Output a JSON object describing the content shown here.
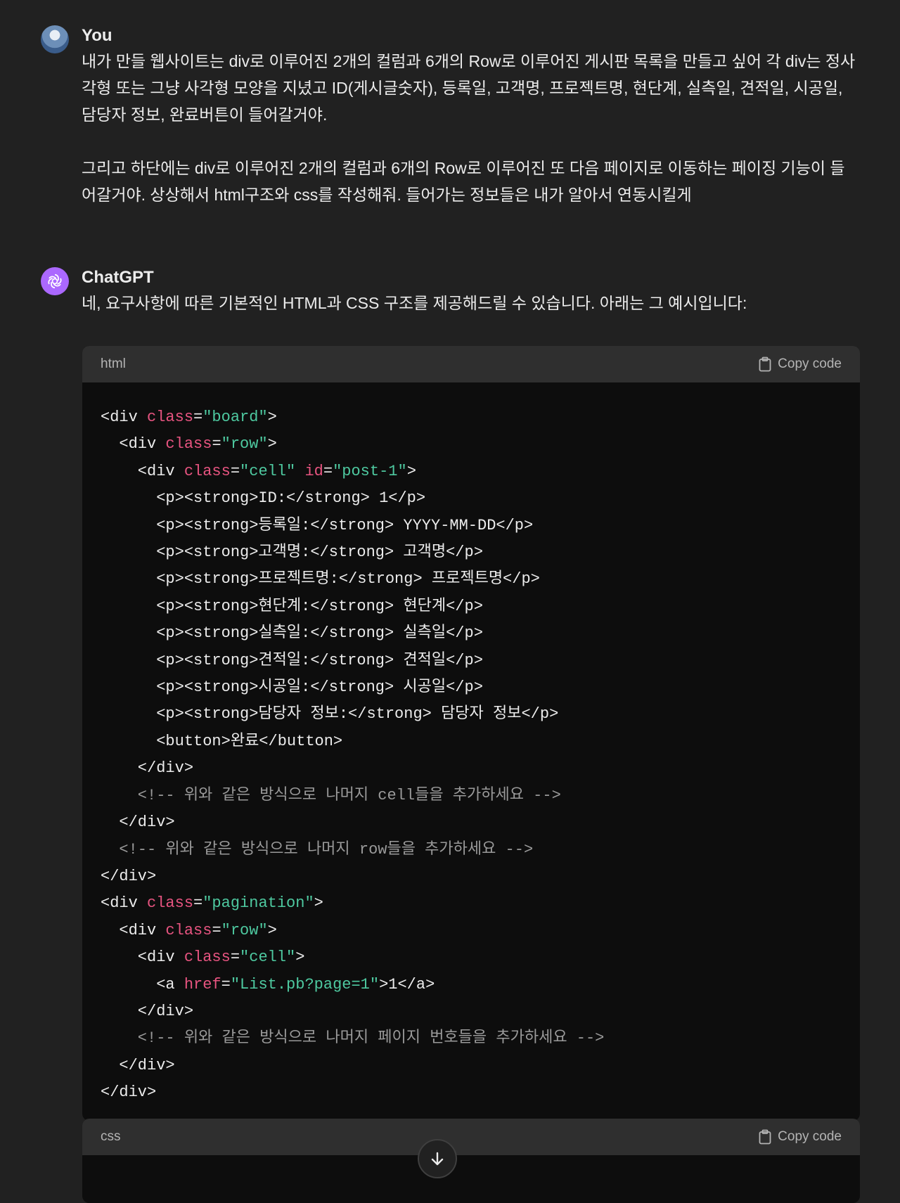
{
  "user_message": {
    "author": "You",
    "paragraphs": [
      "내가 만들 웹사이트는 div로 이루어진 2개의 컬럼과 6개의 Row로 이루어진 게시판 목록을 만들고 싶어 각 div는 정사각형 또는 그냥 사각형 모양을 지녔고 ID(게시글숫자), 등록일, 고객명, 프로젝트명, 현단계, 실측일, 견적일, 시공일, 담당자 정보, 완료버튼이 들어갈거야.",
      "그리고 하단에는  div로 이루어진 2개의 컬럼과 6개의 Row로 이루어진 또 다음 페이지로 이동하는 페이징 기능이 들어갈거야. 상상해서 html구조와 css를 작성해줘. 들어가는 정보들은 내가 알아서 연동시킬게"
    ]
  },
  "assistant_message": {
    "author": "ChatGPT",
    "intro": "네, 요구사항에 따른 기본적인 HTML과 CSS 구조를 제공해드릴 수 있습니다. 아래는 그 예시입니다:"
  },
  "code_blocks": [
    {
      "language": "html",
      "copy_label": "Copy code",
      "lines": [
        [
          [
            "t",
            "<div "
          ],
          [
            "a",
            "class"
          ],
          [
            "t",
            "="
          ],
          [
            "s",
            "\"board\""
          ],
          [
            "t",
            ">"
          ]
        ],
        [
          [
            "t",
            "  <div "
          ],
          [
            "a",
            "class"
          ],
          [
            "t",
            "="
          ],
          [
            "s",
            "\"row\""
          ],
          [
            "t",
            ">"
          ]
        ],
        [
          [
            "t",
            "    <div "
          ],
          [
            "a",
            "class"
          ],
          [
            "t",
            "="
          ],
          [
            "s",
            "\"cell\""
          ],
          [
            "t",
            " "
          ],
          [
            "a",
            "id"
          ],
          [
            "t",
            "="
          ],
          [
            "s",
            "\"post-1\""
          ],
          [
            "t",
            ">"
          ]
        ],
        [
          [
            "t",
            "      <p><strong>ID:</strong> 1</p>"
          ]
        ],
        [
          [
            "t",
            "      <p><strong>등록일:</strong> YYYY-MM-DD</p>"
          ]
        ],
        [
          [
            "t",
            "      <p><strong>고객명:</strong> 고객명</p>"
          ]
        ],
        [
          [
            "t",
            "      <p><strong>프로젝트명:</strong> 프로젝트명</p>"
          ]
        ],
        [
          [
            "t",
            "      <p><strong>현단계:</strong> 현단계</p>"
          ]
        ],
        [
          [
            "t",
            "      <p><strong>실측일:</strong> 실측일</p>"
          ]
        ],
        [
          [
            "t",
            "      <p><strong>견적일:</strong> 견적일</p>"
          ]
        ],
        [
          [
            "t",
            "      <p><strong>시공일:</strong> 시공일</p>"
          ]
        ],
        [
          [
            "t",
            "      <p><strong>담당자 정보:</strong> 담당자 정보</p>"
          ]
        ],
        [
          [
            "t",
            "      <button>완료</button>"
          ]
        ],
        [
          [
            "t",
            "    </div>"
          ]
        ],
        [
          [
            "c",
            "    <!-- 위와 같은 방식으로 나머지 cell들을 추가하세요 -->"
          ]
        ],
        [
          [
            "t",
            "  </div>"
          ]
        ],
        [
          [
            "c",
            "  <!-- 위와 같은 방식으로 나머지 row들을 추가하세요 -->"
          ]
        ],
        [
          [
            "t",
            "</div>"
          ]
        ],
        [
          [
            "t",
            "<div "
          ],
          [
            "a",
            "class"
          ],
          [
            "t",
            "="
          ],
          [
            "s",
            "\"pagination\""
          ],
          [
            "t",
            ">"
          ]
        ],
        [
          [
            "t",
            "  <div "
          ],
          [
            "a",
            "class"
          ],
          [
            "t",
            "="
          ],
          [
            "s",
            "\"row\""
          ],
          [
            "t",
            ">"
          ]
        ],
        [
          [
            "t",
            "    <div "
          ],
          [
            "a",
            "class"
          ],
          [
            "t",
            "="
          ],
          [
            "s",
            "\"cell\""
          ],
          [
            "t",
            ">"
          ]
        ],
        [
          [
            "t",
            "      <a "
          ],
          [
            "a",
            "href"
          ],
          [
            "t",
            "="
          ],
          [
            "s",
            "\"List.pb?page=1\""
          ],
          [
            "t",
            ">1</a>"
          ]
        ],
        [
          [
            "t",
            "    </div>"
          ]
        ],
        [
          [
            "c",
            "    <!-- 위와 같은 방식으로 나머지 페이지 번호들을 추가하세요 -->"
          ]
        ],
        [
          [
            "t",
            "  </div>"
          ]
        ],
        [
          [
            "t",
            "</div>"
          ]
        ]
      ]
    },
    {
      "language": "css",
      "copy_label": "Copy code",
      "lines": []
    }
  ],
  "icons": {
    "copy": "clipboard-icon",
    "scroll": "arrow-down-icon",
    "assistant_avatar": "openai-logo-icon"
  },
  "colors": {
    "background": "#212121",
    "code_bg": "#0d0d0d",
    "code_header_bg": "#2f2f2f",
    "attr": "#e75480",
    "string": "#4ec9a0",
    "comment": "#9a9a9a",
    "assistant_avatar": "#ab68ff"
  }
}
